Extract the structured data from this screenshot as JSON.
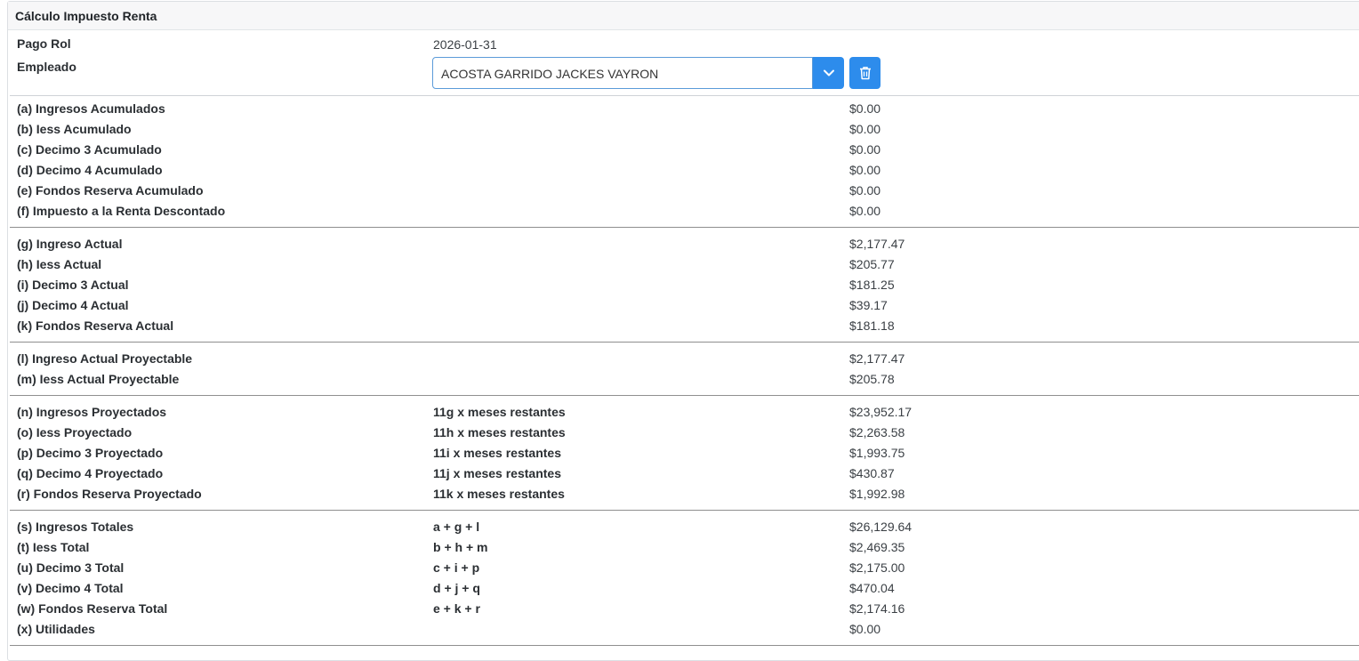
{
  "panel": {
    "title": "Cálculo Impuesto Renta"
  },
  "header": {
    "pago_rol_label": "Pago Rol",
    "pago_rol_value": "2026-01-31",
    "empleado_label": "Empleado",
    "empleado_value": "ACOSTA GARRIDO JACKES VAYRON"
  },
  "icons": {
    "dropdown": "chevron-down-icon",
    "delete": "trash-icon"
  },
  "colors": {
    "accent": "#2d8cec",
    "select_border": "#5b9bd9"
  },
  "groups": [
    {
      "rows": [
        {
          "label": "(a) Ingresos Acumulados",
          "formula": "",
          "value": "$0.00"
        },
        {
          "label": "(b) Iess Acumulado",
          "formula": "",
          "value": "$0.00"
        },
        {
          "label": "(c) Decimo 3 Acumulado",
          "formula": "",
          "value": "$0.00"
        },
        {
          "label": "(d) Decimo 4 Acumulado",
          "formula": "",
          "value": "$0.00"
        },
        {
          "label": "(e) Fondos Reserva Acumulado",
          "formula": "",
          "value": "$0.00"
        },
        {
          "label": "(f) Impuesto a la Renta Descontado",
          "formula": "",
          "value": "$0.00"
        }
      ]
    },
    {
      "rows": [
        {
          "label": "(g) Ingreso Actual",
          "formula": "",
          "value": "$2,177.47"
        },
        {
          "label": "(h) Iess Actual",
          "formula": "",
          "value": "$205.77"
        },
        {
          "label": "(i) Decimo 3 Actual",
          "formula": "",
          "value": "$181.25"
        },
        {
          "label": "(j) Decimo 4 Actual",
          "formula": "",
          "value": "$39.17"
        },
        {
          "label": "(k) Fondos Reserva Actual",
          "formula": "",
          "value": "$181.18"
        }
      ]
    },
    {
      "rows": [
        {
          "label": "(l) Ingreso Actual Proyectable",
          "formula": "",
          "value": "$2,177.47"
        },
        {
          "label": "(m) Iess Actual Proyectable",
          "formula": "",
          "value": "$205.78"
        }
      ]
    },
    {
      "rows": [
        {
          "label": "(n) Ingresos Proyectados",
          "formula": "11g x meses restantes",
          "value": "$23,952.17"
        },
        {
          "label": "(o) Iess Proyectado",
          "formula": "11h x meses restantes",
          "value": "$2,263.58"
        },
        {
          "label": "(p) Decimo 3 Proyectado",
          "formula": "11i x meses restantes",
          "value": "$1,993.75"
        },
        {
          "label": "(q) Decimo 4 Proyectado",
          "formula": "11j x meses restantes",
          "value": "$430.87"
        },
        {
          "label": "(r) Fondos Reserva Proyectado",
          "formula": "11k x meses restantes",
          "value": "$1,992.98"
        }
      ]
    },
    {
      "rows": [
        {
          "label": "(s) Ingresos Totales",
          "formula": "a + g + l",
          "value": "$26,129.64"
        },
        {
          "label": "(t) Iess Total",
          "formula": "b + h + m",
          "value": "$2,469.35"
        },
        {
          "label": "(u) Decimo 3 Total",
          "formula": "c + i + p",
          "value": "$2,175.00"
        },
        {
          "label": "(v) Decimo 4 Total",
          "formula": "d + j + q",
          "value": "$470.04"
        },
        {
          "label": "(w) Fondos Reserva Total",
          "formula": "e + k + r",
          "value": "$2,174.16"
        },
        {
          "label": "(x) Utilidades",
          "formula": "",
          "value": "$0.00"
        }
      ]
    }
  ]
}
